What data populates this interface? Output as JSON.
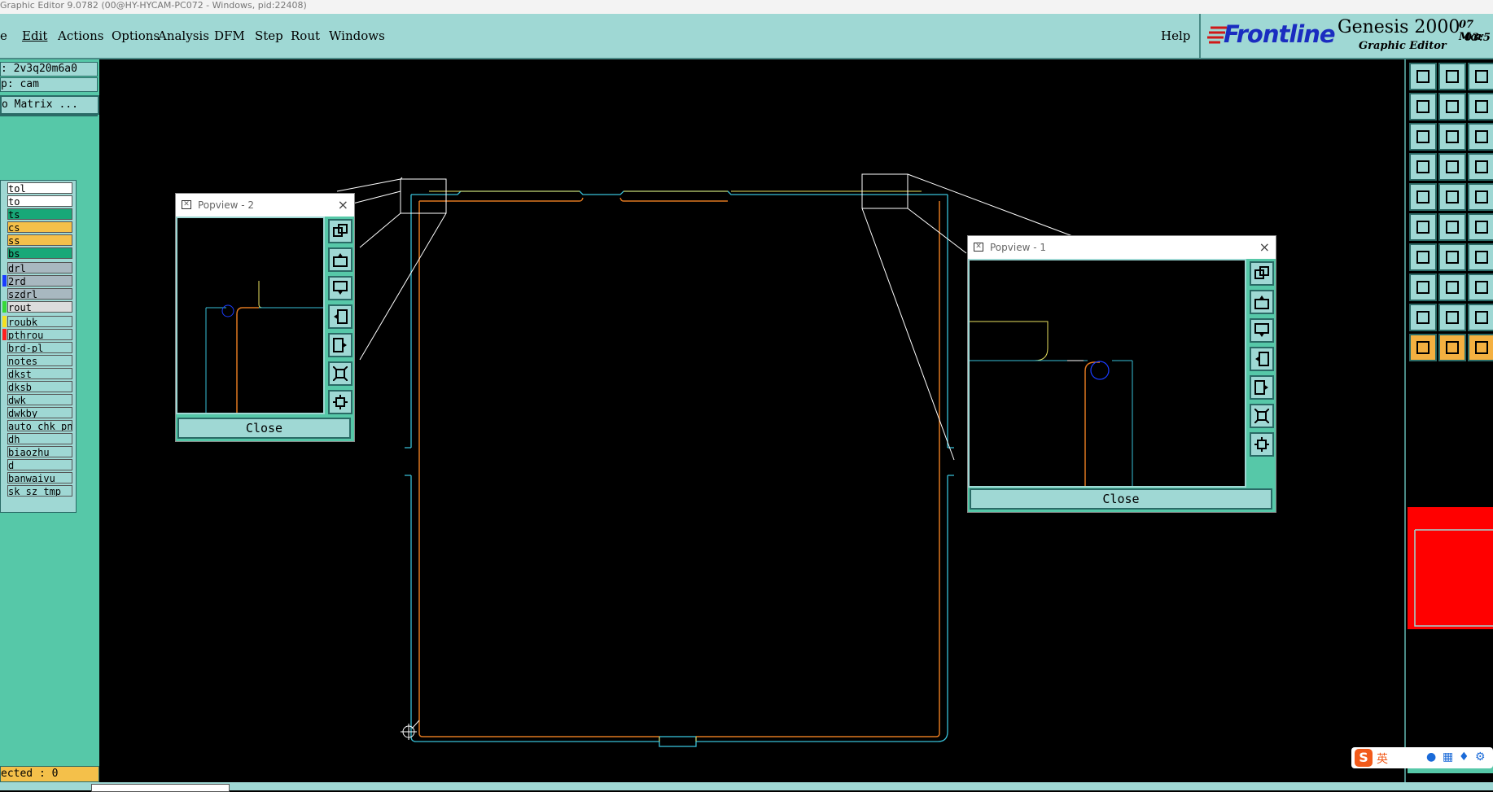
{
  "window": {
    "title": "Graphic Editor 9.0782 (00@HY-HYCAM-PC072 - Windows, pid:22408)"
  },
  "menu": {
    "items": [
      "e",
      "Edit",
      "Actions",
      "Options",
      "Analysis",
      "DFM",
      "Step",
      "Rout",
      "Windows"
    ],
    "help": "Help"
  },
  "brand": {
    "logo": "Frontline",
    "product": "Genesis 2000",
    "subtitle": "Graphic Editor",
    "date": "07 Mar",
    "time": "03:5"
  },
  "left_panel": {
    "job_field": ": 2v3q20m6a0",
    "step_field": "p: cam",
    "matrix_button": "o Matrix ...",
    "layers": [
      {
        "name": "tol",
        "bg": "#ffffff",
        "mark": ""
      },
      {
        "name": "to",
        "bg": "#ffffff",
        "mark": ""
      },
      {
        "name": "ts",
        "bg": "#18a878",
        "mark": ""
      },
      {
        "name": "cs",
        "bg": "#f4c04a",
        "mark": ""
      },
      {
        "name": "ss",
        "bg": "#f4c04a",
        "mark": ""
      },
      {
        "name": "bs",
        "bg": "#18a878",
        "mark": ""
      },
      {
        "name": "drl",
        "bg": "#a8b8c0",
        "mark": ""
      },
      {
        "name": "2rd",
        "bg": "#a8b8c0",
        "mark": "#1a3cff"
      },
      {
        "name": "szdrl",
        "bg": "#a8b8c0",
        "mark": ""
      },
      {
        "name": "rout",
        "bg": "#dcdcdc",
        "mark": "#38d838"
      },
      {
        "name": "roubk",
        "bg": "#9fd8d4",
        "mark": "#f4e020"
      },
      {
        "name": "pthrou",
        "bg": "#9fd8d4",
        "mark": "#ff2020"
      },
      {
        "name": "brd-pl",
        "bg": "#9fd8d4",
        "mark": ""
      },
      {
        "name": "notes",
        "bg": "#9fd8d4",
        "mark": ""
      },
      {
        "name": "dkst",
        "bg": "#9fd8d4",
        "mark": ""
      },
      {
        "name": "dksb",
        "bg": "#9fd8d4",
        "mark": ""
      },
      {
        "name": "dwk",
        "bg": "#9fd8d4",
        "mark": ""
      },
      {
        "name": "dwkby",
        "bg": "#9fd8d4",
        "mark": ""
      },
      {
        "name": "auto_chk_pn",
        "bg": "#9fd8d4",
        "mark": ""
      },
      {
        "name": "dh",
        "bg": "#9fd8d4",
        "mark": ""
      },
      {
        "name": "biaozhu",
        "bg": "#9fd8d4",
        "mark": ""
      },
      {
        "name": "d",
        "bg": "#9fd8d4",
        "mark": ""
      },
      {
        "name": "banwaivu",
        "bg": "#9fd8d4",
        "mark": ""
      },
      {
        "name": "sk_sz_tmp",
        "bg": "#9fd8d4",
        "mark": ""
      }
    ],
    "status": "ected : 0"
  },
  "popview2": {
    "title": "Popview - 2",
    "close_label": "Close"
  },
  "popview1": {
    "title": "Popview - 1",
    "close_label": "Close"
  },
  "colors": {
    "teal": "#9fd8d4",
    "green": "#56c8a8",
    "orange_outline": "#e07820",
    "cyan_outline": "#38c0d8",
    "yellow_line": "#e8e060",
    "preview_red": "#ff0000"
  },
  "tray": {
    "ime": "英"
  }
}
